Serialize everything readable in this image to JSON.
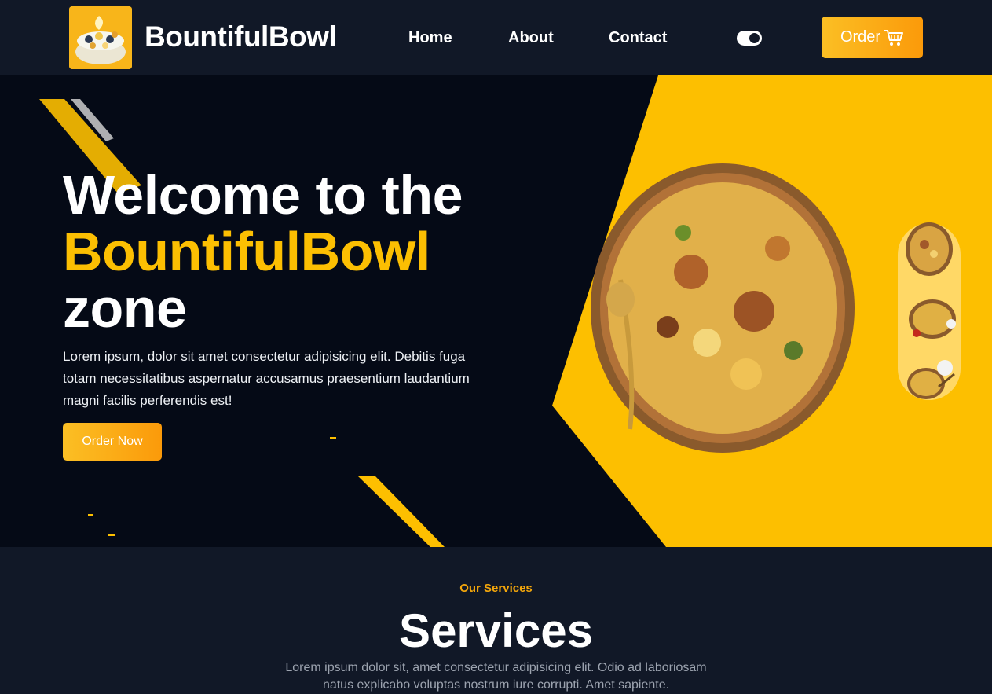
{
  "nav": {
    "brand": "BountifulBowl",
    "links": [
      "Home",
      "About",
      "Contact"
    ],
    "order_label": "Order"
  },
  "hero": {
    "title_line1": "Welcome to the",
    "title_accent": "BountifulBowl",
    "title_line3": "zone",
    "paragraph": "Lorem ipsum, dolor sit amet consectetur adipisicing elit. Debitis fuga totam necessitatibus aspernatur accusamus praesentium laudantium magni facilis perferendis est!",
    "cta_label": "Order Now"
  },
  "services": {
    "kicker": "Our Services",
    "title": "Services",
    "text": "Lorem ipsum dolor sit, amet consectetur adipisicing elit. Odio ad laboriosam natus explicabo voluptas nostrum iure corrupti. Amet sapiente."
  },
  "colors": {
    "accent": "#fcbf02",
    "background": "#111827",
    "hero_bg": "#050a16"
  },
  "icons": [
    "cart-icon",
    "theme-toggle-icon"
  ]
}
